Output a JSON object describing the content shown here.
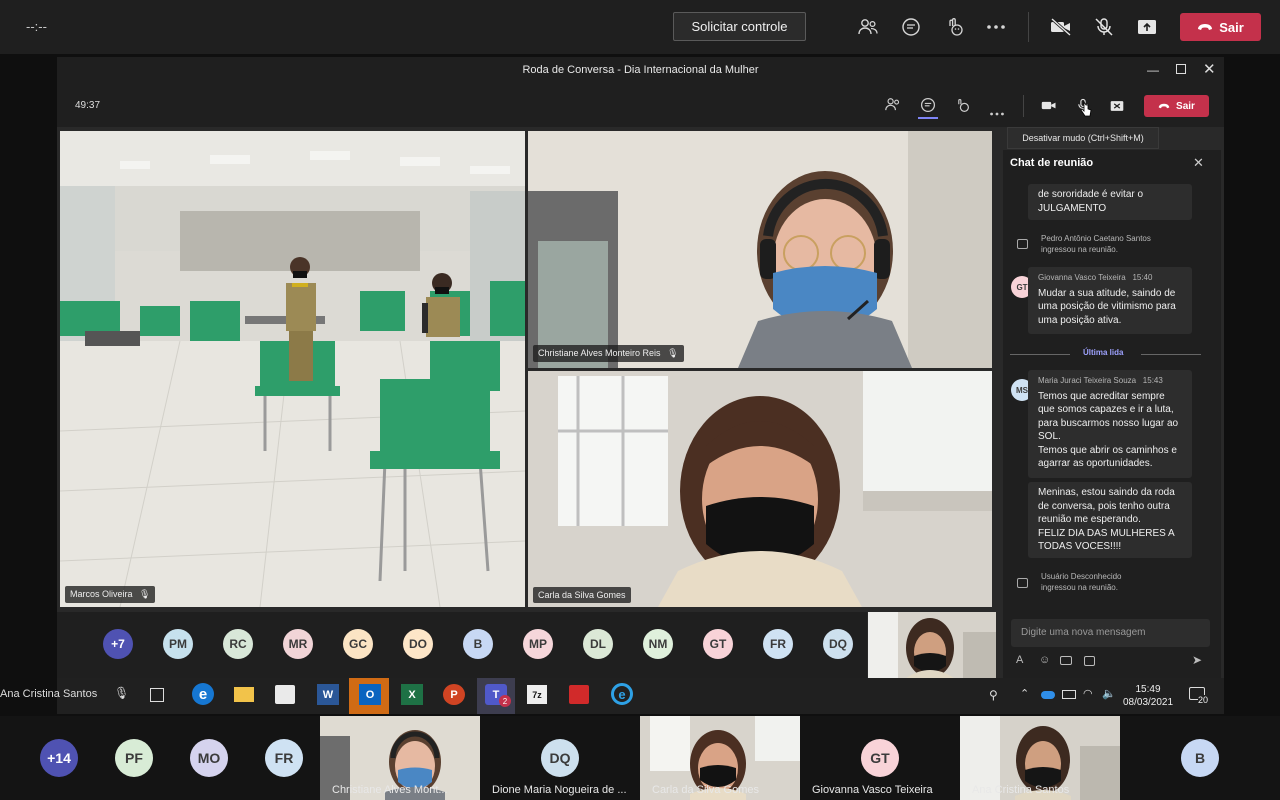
{
  "outer_bar": {
    "timer": "--:--",
    "request_control_label": "Solicitar controle",
    "leave_label": "Sair"
  },
  "window": {
    "title": "Roda de Conversa - Dia Internacional da Mulher"
  },
  "meeting": {
    "timer": "49:37",
    "leave_label": "Sair",
    "tooltip": "Desativar mudo (Ctrl+Shift+M)"
  },
  "video_tiles": {
    "tile1_name": "Marcos Oliveira",
    "tile2_name": "Christiane Alves Monteiro Reis",
    "tile3_name": "Carla da Silva Gomes"
  },
  "chat": {
    "title": "Chat de reunião",
    "msg_partial": [
      "de sororidade é evitar o",
      "JULGAMENTO"
    ],
    "sys1": {
      "name": "Pedro Antônio Caetano Santos",
      "text": "ingressou na reunião."
    },
    "msg2": {
      "initials": "GT",
      "sender": "Giovanna Vasco Teixeira",
      "time": "15:40",
      "lines": [
        "Mudar a sua atitude, saindo de",
        "uma posição de vitimismo para",
        "uma posição ativa."
      ]
    },
    "last_read": "Última lida",
    "msg3": {
      "initials": "MS",
      "sender": "Maria Juraci Teixeira Souza",
      "time": "15:43",
      "lines": [
        "Temos que acreditar sempre",
        "que somos capazes e ir a luta,",
        "para buscarmos nosso lugar ao",
        "SOL.",
        "Temos que abrir os caminhos e",
        "agarrar as oportunidades."
      ]
    },
    "msg4_lines": [
      "Meninas, estou saindo da roda",
      "de conversa, pois tenho outra",
      "reunião me esperando.",
      "FELIZ DIA DAS MULHERES A",
      "TODAS VOCES!!!!"
    ],
    "sys2": {
      "name": "Usuário Desconhecido",
      "text": "ingressou na reunião."
    },
    "input_placeholder": "Digite uma nova mensagem"
  },
  "inner_participants": [
    {
      "initials": "+7",
      "bg": "#4f52b2",
      "fg": "#ffffff"
    },
    {
      "initials": "PM",
      "bg": "#c6e1ed",
      "fg": "#3b3b3b"
    },
    {
      "initials": "RC",
      "bg": "#d8e7d8",
      "fg": "#3b3b3b"
    },
    {
      "initials": "MR",
      "bg": "#f1d4d7",
      "fg": "#3b3b3b"
    },
    {
      "initials": "GC",
      "bg": "#fbe4c4",
      "fg": "#3b3b3b"
    },
    {
      "initials": "DO",
      "bg": "#fde6c8",
      "fg": "#3b3b3b"
    },
    {
      "initials": "B",
      "bg": "#c7d8f4",
      "fg": "#3b3b3b"
    },
    {
      "initials": "MP",
      "bg": "#f6d6da",
      "fg": "#3b3b3b"
    },
    {
      "initials": "DL",
      "bg": "#dbe8d6",
      "fg": "#3b3b3b"
    },
    {
      "initials": "NM",
      "bg": "#dff0dc",
      "fg": "#3b3b3b"
    },
    {
      "initials": "GT",
      "bg": "#f8d3d8",
      "fg": "#3b3b3b"
    },
    {
      "initials": "FR",
      "bg": "#cfe2f3",
      "fg": "#3b3b3b"
    },
    {
      "initials": "DQ",
      "bg": "#cde0ee",
      "fg": "#3b3b3b"
    }
  ],
  "taskbar": {
    "self_name": "Ana Cristina Santos",
    "teams_badge": "2",
    "time": "15:49",
    "date": "08/03/2021",
    "notifications": "20"
  },
  "bottom_strip": {
    "avatars": [
      {
        "initials": "+14",
        "bg": "#4f52b2",
        "fg": "#ffffff"
      },
      {
        "initials": "PF",
        "bg": "#d8ecd6",
        "fg": "#3b3b3b"
      },
      {
        "initials": "MO",
        "bg": "#d5d3ee",
        "fg": "#3b3b3b"
      },
      {
        "initials": "FR",
        "bg": "#cfe2f3",
        "fg": "#3b3b3b"
      }
    ],
    "tiles": [
      {
        "name": "Christiane Alves Mont...",
        "type": "video"
      },
      {
        "name": "Dione Maria Nogueira de ...",
        "initials": "DQ",
        "type": "avatar",
        "bg": "#cde0ee"
      },
      {
        "name": "Carla da Silva Gomes",
        "type": "video"
      },
      {
        "name": "Giovanna Vasco Teixeira",
        "initials": "GT",
        "type": "avatar",
        "bg": "#f8d3d8"
      },
      {
        "name": "Ana Cristina Santos",
        "type": "video"
      },
      {
        "initials": "B",
        "type": "avatar",
        "bg": "#c7d8f4"
      }
    ]
  }
}
